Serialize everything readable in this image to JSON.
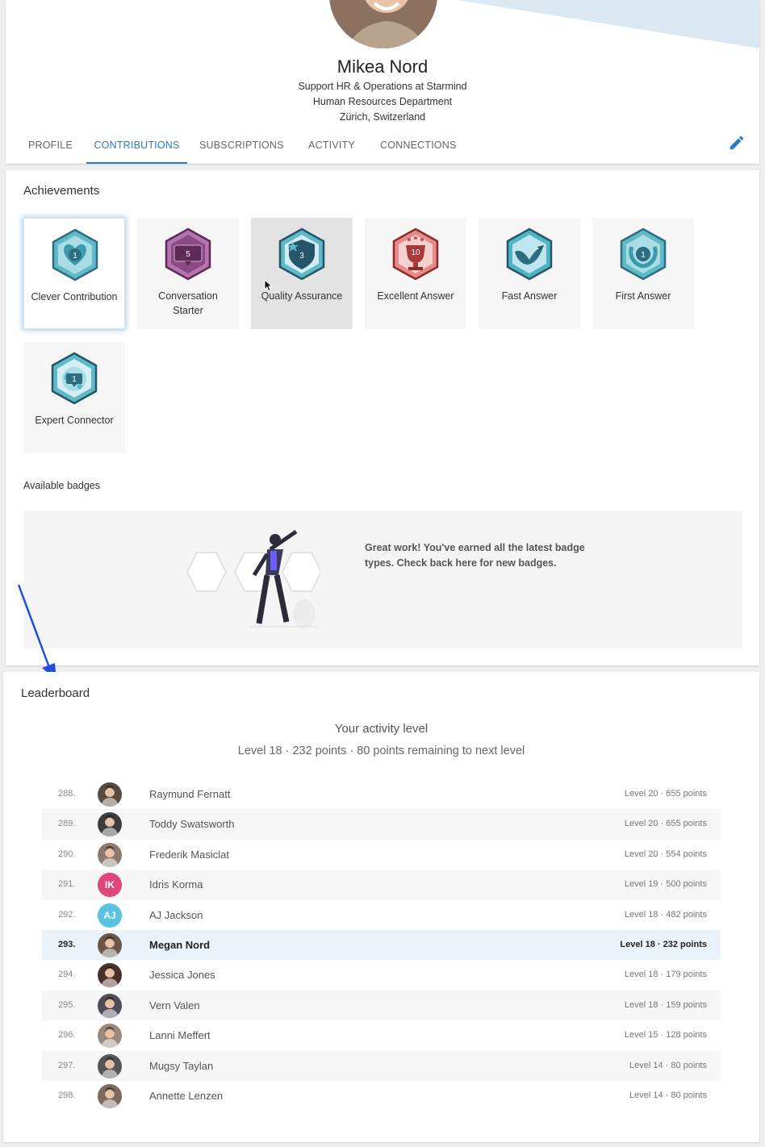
{
  "profile": {
    "name": "Mikea Nord",
    "role": "Support HR & Operations at Starmind",
    "department": "Human Resources Department",
    "location": "Zürich, Switzerland"
  },
  "tabs": [
    {
      "label": "PROFILE",
      "active": false
    },
    {
      "label": "CONTRIBUTIONS",
      "active": true
    },
    {
      "label": "SUBSCRIPTIONS",
      "active": false
    },
    {
      "label": "ACTIVITY",
      "active": false
    },
    {
      "label": "CONNECTIONS",
      "active": false
    }
  ],
  "achievements": {
    "title": "Achievements",
    "badges": [
      {
        "label": "Clever Contribution",
        "count": "1",
        "color": "#5fb9c7",
        "icon": "heart-hands-badge-icon"
      },
      {
        "label": "Conversation Starter",
        "count": "5",
        "color": "#8a4a84",
        "icon": "speech-bubble-badge-icon"
      },
      {
        "label": "Quality Assurance",
        "count": "3",
        "color": "#2d6d82",
        "icon": "shield-badge-icon"
      },
      {
        "label": "Excellent Answer",
        "count": "10",
        "color": "#c54c4c",
        "icon": "trophy-badge-icon"
      },
      {
        "label": "Fast Answer",
        "count": "",
        "color": "#4fb3c4",
        "icon": "bird-badge-icon"
      },
      {
        "label": "First Answer",
        "count": "1",
        "color": "#5fb9c7",
        "icon": "laurel-badge-icon"
      },
      {
        "label": "Expert Connector",
        "count": "1",
        "color": "#5fb9c7",
        "icon": "globe-badge-icon"
      }
    ],
    "available_title": "Available badges",
    "available_message": "Great work! You've earned all the latest badge types. Check back here for new badges."
  },
  "leaderboard": {
    "title": "Leaderboard",
    "level_title": "Your activity level",
    "level_summary": "Level 18 · 232 points · 80 points remaining to next level",
    "rows": [
      {
        "rank": "288.",
        "name": "Raymund Fernatt",
        "score": "Level 20 · 655 points",
        "avatar": "#5a4a3e",
        "initials": ""
      },
      {
        "rank": "289.",
        "name": "Toddy Swatsworth",
        "score": "Level 20 · 655 points",
        "avatar": "#3d3d3d",
        "initials": ""
      },
      {
        "rank": "290.",
        "name": "Frederik Masiclat",
        "score": "Level 20 · 554 points",
        "avatar": "#8a7a70",
        "initials": ""
      },
      {
        "rank": "291.",
        "name": "Idris Korma",
        "score": "Level 19 · 500 points",
        "avatar": "#e0457b",
        "initials": "IK"
      },
      {
        "rank": "292.",
        "name": "AJ Jackson",
        "score": "Level 18 · 482 points",
        "avatar": "#5bc2e0",
        "initials": "AJ"
      },
      {
        "rank": "293.",
        "name": "Megan Nord",
        "score": "Level 18 · 232 points",
        "avatar": "#6b5547",
        "initials": ""
      },
      {
        "rank": "294.",
        "name": "Jessica Jones",
        "score": "Level 18 · 179 points",
        "avatar": "#4a3228",
        "initials": ""
      },
      {
        "rank": "295.",
        "name": "Vern Valen",
        "score": "Level 18 · 159 points",
        "avatar": "#4d4d55",
        "initials": ""
      },
      {
        "rank": "296.",
        "name": "Lanni Meffert",
        "score": "Level 15 · 128 points",
        "avatar": "#9a8a7e",
        "initials": ""
      },
      {
        "rank": "297.",
        "name": "Mugsy Taylan",
        "score": "Level 14 · 80 points",
        "avatar": "#555555",
        "initials": ""
      },
      {
        "rank": "298.",
        "name": "Annette Lenzen",
        "score": "Level 14 · 80 points",
        "avatar": "#7a6a60",
        "initials": ""
      }
    ]
  },
  "colors": {
    "accent": "#2979c4",
    "annotation_arrow": "#1f4fe0"
  }
}
